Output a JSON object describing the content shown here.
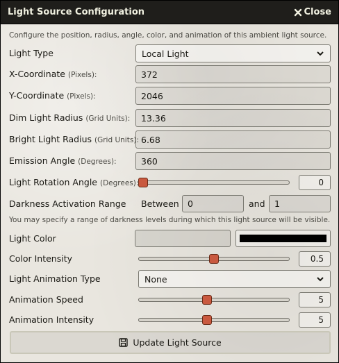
{
  "window": {
    "title": "Light Source Configuration",
    "close_label": "Close"
  },
  "hint_top": "Configure the position, radius, angle, color, and animation of this ambient light source.",
  "light_type": {
    "label": "Light Type",
    "value": "Local Light"
  },
  "x_coord": {
    "label": "X-Coordinate",
    "unit": "(Pixels):",
    "value": "372"
  },
  "y_coord": {
    "label": "Y-Coordinate",
    "unit": "(Pixels):",
    "value": "2046"
  },
  "dim_radius": {
    "label": "Dim Light Radius",
    "unit": "(Grid Units):",
    "value": "13.36"
  },
  "bright_radius": {
    "label": "Bright Light Radius",
    "unit": "(Grid Units):",
    "value": "6.68"
  },
  "emission_angle": {
    "label": "Emission Angle",
    "unit": "(Degrees):",
    "value": "360"
  },
  "rotation": {
    "label": "Light Rotation Angle",
    "unit": "(Degrees):",
    "value": "0",
    "level": 0.0
  },
  "darkness": {
    "label": "Darkness Activation Range",
    "between": "Between",
    "min": "0",
    "and": "and",
    "max": "1"
  },
  "hint_darkness": "You may specify a range of darkness levels during which this light source will be visible.",
  "light_color": {
    "label": "Light Color",
    "color": "#000000"
  },
  "color_intensity": {
    "label": "Color Intensity",
    "value": "0.5",
    "level": 0.5
  },
  "animation_type": {
    "label": "Light Animation Type",
    "value": "None"
  },
  "animation_speed": {
    "label": "Animation Speed",
    "value": "5",
    "level": 0.45
  },
  "animation_intensity": {
    "label": "Animation Intensity",
    "value": "5",
    "level": 0.45
  },
  "submit": {
    "label": "Update Light Source"
  },
  "colors": {
    "header_bg": "#1f1e1b",
    "slider_thumb": "#c9593f",
    "panel_bg": "#e9e6df"
  }
}
